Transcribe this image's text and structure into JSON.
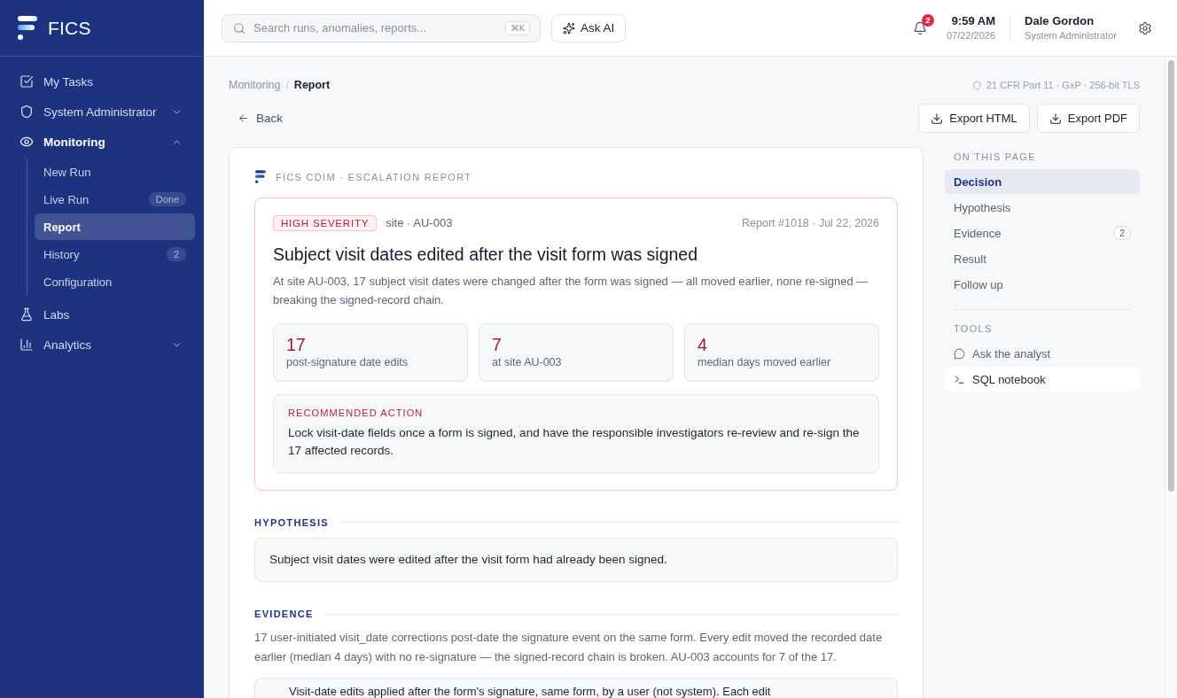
{
  "sidebar": {
    "brand": "FICS",
    "items": [
      {
        "kind": "link",
        "label": "My Tasks",
        "active": false
      },
      {
        "kind": "group",
        "label": "System Administrator",
        "active": false,
        "expanded": false
      },
      {
        "kind": "group",
        "label": "Monitoring",
        "active": true,
        "expanded": true,
        "children": [
          {
            "label": "New Run",
            "selected": false
          },
          {
            "label": "Live Run",
            "selected": false,
            "badge": "Done"
          },
          {
            "label": "Report",
            "selected": true
          },
          {
            "label": "History",
            "selected": false,
            "badge": "2"
          },
          {
            "label": "Configuration",
            "selected": false
          }
        ]
      },
      {
        "kind": "link",
        "label": "Labs",
        "active": false
      },
      {
        "kind": "group",
        "label": "Analytics",
        "active": false,
        "expanded": false
      }
    ]
  },
  "top_bar": {
    "search": {
      "placeholder": "Search runs, anomalies, reports...",
      "shortcut": "⌘K"
    },
    "ask_ai": "Ask AI",
    "notifications": {
      "count": "2"
    },
    "clock": {
      "time": "9:59 AM",
      "date": "07/22/2026"
    },
    "user": {
      "name": "Dale Gordon",
      "role": "System Administrator"
    }
  },
  "page": {
    "breadcrumb": {
      "separator": "/",
      "items": [
        {
          "label": "Monitoring",
          "selected": false
        },
        {
          "label": "Report",
          "selected": true
        }
      ]
    },
    "compliance": "21 CFR Part 11 · GxP · 256-bit TLS",
    "back": "Back",
    "exports": [
      "Export HTML",
      "Export PDF"
    ]
  },
  "report": {
    "kicker": "FICS CDIM · ESCALATION REPORT",
    "decision": {
      "severity": "HIGH SEVERITY",
      "site": "site · AU-003",
      "meta": "Report #1018 · Jul 22, 2026",
      "title": "Subject visit dates edited after the visit form was signed",
      "summary": "At site AU-003, 17 subject visit dates were changed after the form was signed — all moved earlier, none re-signed — breaking the signed-record chain.",
      "stats": [
        {
          "value": "17",
          "label": "post-signature date edits"
        },
        {
          "value": "7",
          "label": "at site AU-003"
        },
        {
          "value": "4",
          "label": "median days moved earlier"
        }
      ],
      "recommendation": {
        "label": "RECOMMENDED ACTION",
        "text": "Lock visit-date fields once a form is signed, and have the responsible investigators re-review and re-sign the 17 affected records."
      }
    },
    "sections": [
      {
        "kind": "statement",
        "heading": "HYPOTHESIS",
        "text": "Subject visit dates were edited after the visit form had already been signed."
      },
      {
        "kind": "evidence",
        "heading": "EVIDENCE",
        "text": "17 user-initiated visit_date corrections post-date the signature event on the same form. Every edit moved the recorded date earlier (median 4 days) with no re-signature — the signed-record chain is broken. AU-003 accounts for 7 of the 17.",
        "items": [
          {
            "text": "Visit-date edits applied after the form's signature, same form, by a user (not system). Each edit"
          }
        ]
      }
    ]
  },
  "rail": {
    "heading": "ON THIS PAGE",
    "items": [
      {
        "label": "Decision",
        "selected": true
      },
      {
        "label": "Hypothesis",
        "selected": false
      },
      {
        "label": "Evidence",
        "selected": false,
        "badge": "2"
      },
      {
        "label": "Result",
        "selected": false
      },
      {
        "label": "Follow up",
        "selected": false
      }
    ],
    "tools_heading": "TOOLS",
    "tools": [
      {
        "label": "Ask the analyst",
        "selected": false
      },
      {
        "label": "SQL notebook",
        "selected": true
      }
    ]
  }
}
